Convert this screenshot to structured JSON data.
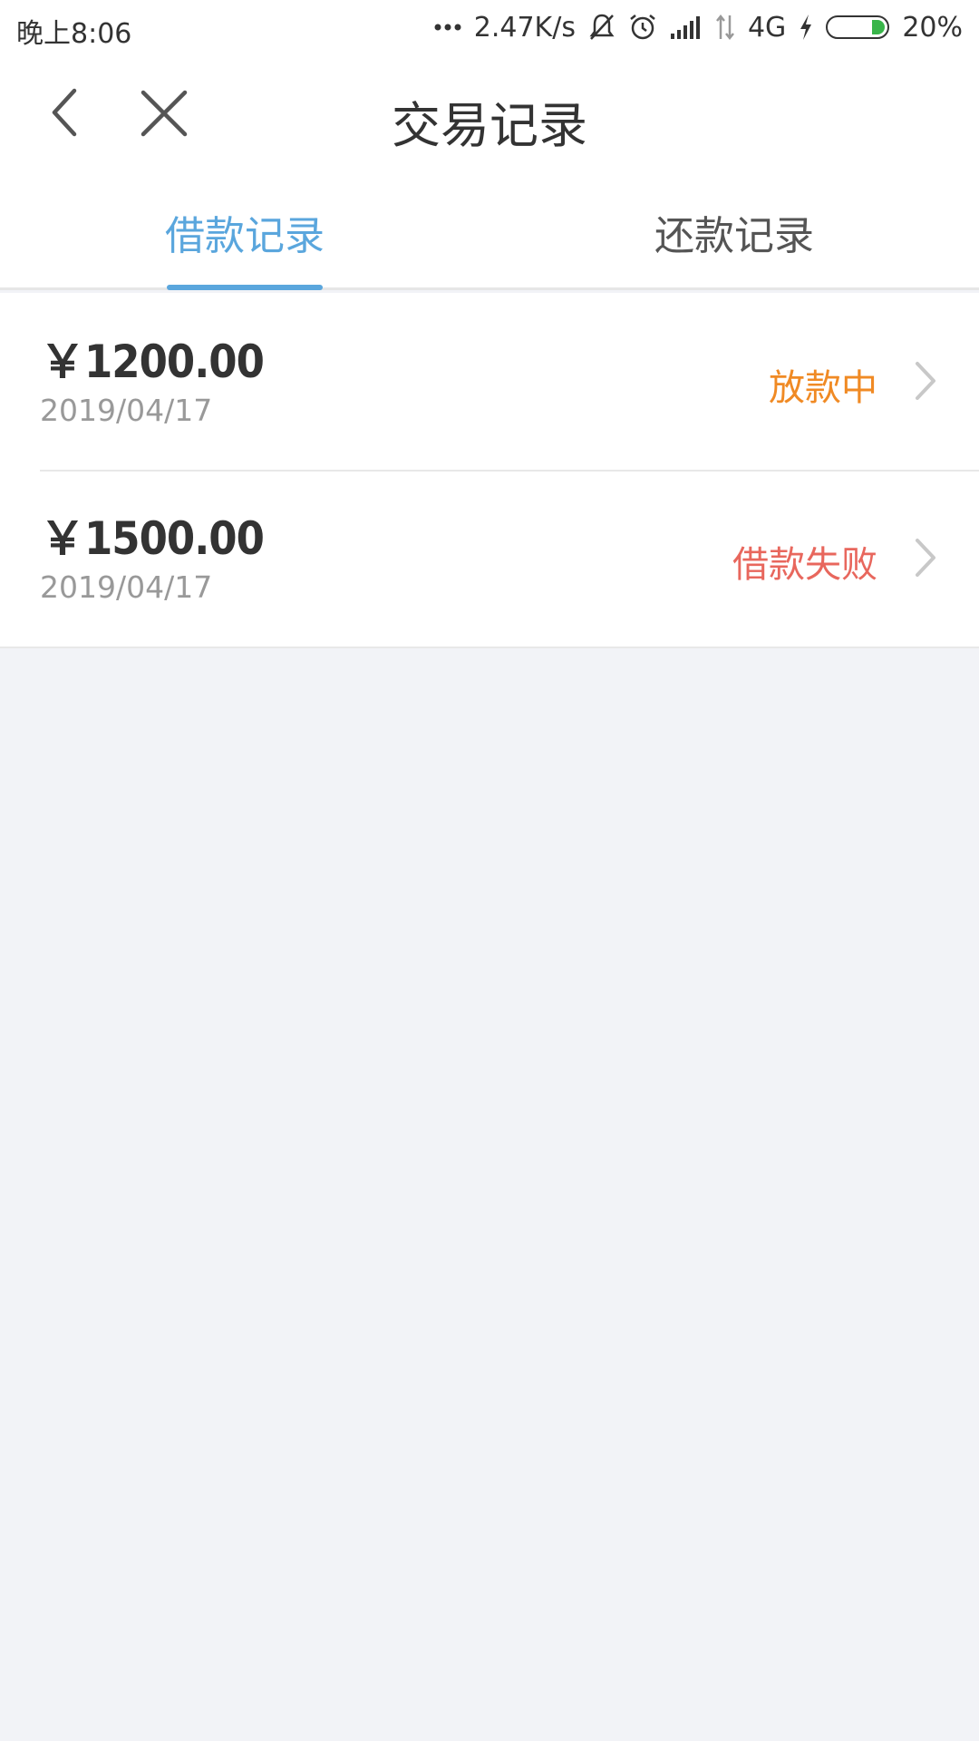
{
  "status_bar": {
    "time": "晚上8:06",
    "net_speed": "2.47K/s",
    "network": "4G",
    "battery": "20%",
    "battery_level": 0.2
  },
  "nav": {
    "title": "交易记录"
  },
  "tabs": [
    {
      "label": "借款记录",
      "active": true
    },
    {
      "label": "还款记录",
      "active": false
    }
  ],
  "records": [
    {
      "amount": "￥1200.00",
      "date": "2019/04/17",
      "status": "放款中",
      "status_color": "#f08a24"
    },
    {
      "amount": "￥1500.00",
      "date": "2019/04/17",
      "status": "借款失败",
      "status_color": "#e8675d"
    }
  ],
  "colors": {
    "accent": "#5aa6dd",
    "background": "#f2f3f7"
  }
}
